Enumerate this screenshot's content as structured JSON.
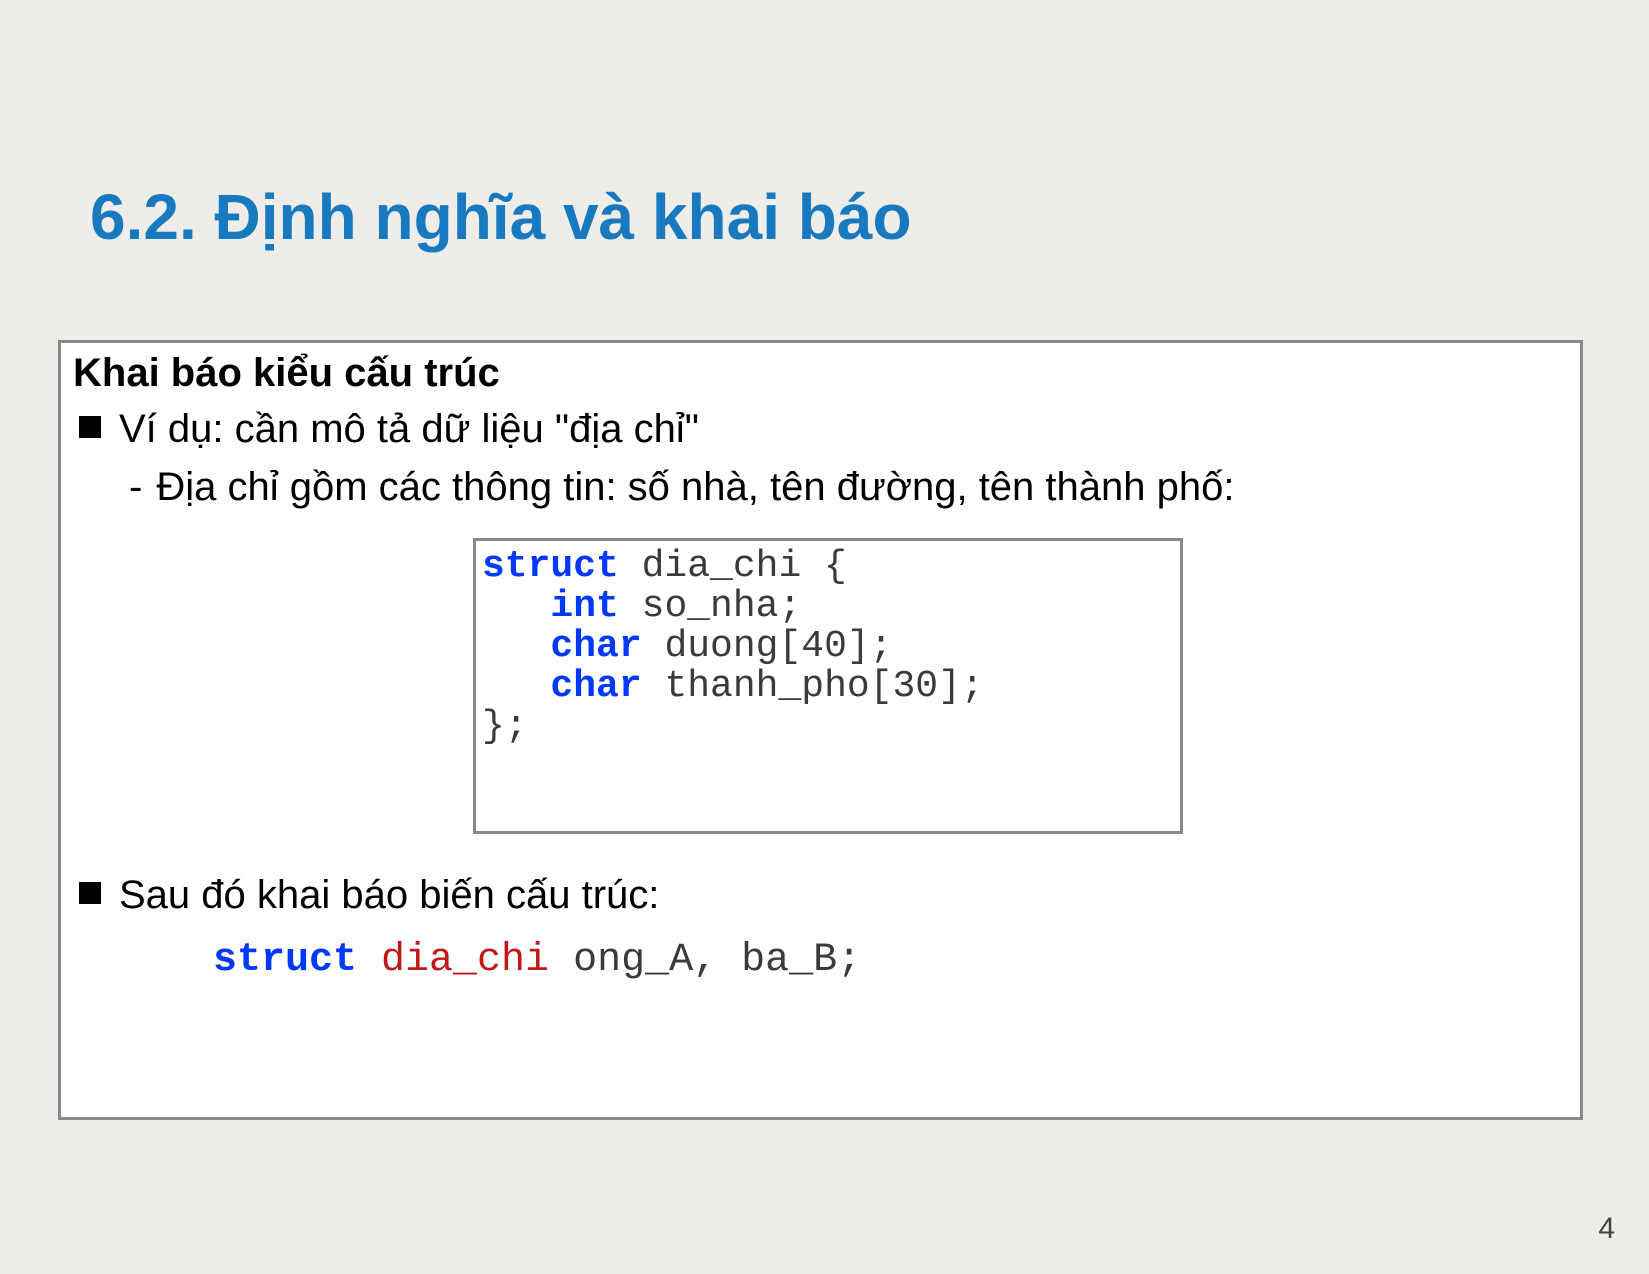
{
  "title": "6.2. Định nghĩa và khai báo",
  "section_header": "Khai báo kiểu cấu trúc",
  "bullet1": "Ví dụ: cần mô tả dữ liệu \"địa chỉ\"",
  "bullet2": "Địa chỉ gồm các thông tin: số nhà, tên đường, tên thành phố:",
  "code": {
    "kw_struct": "struct",
    "t1": " dia_chi {",
    "indent": "   ",
    "kw_int": "int",
    "t2": " so_nha;",
    "kw_char1": "char",
    "t3": " duong[40];",
    "kw_char2": "char",
    "t4": " thanh_pho[30];",
    "t5": "};"
  },
  "bullet3": "Sau đó khai báo biến cấu trúc:",
  "decl": {
    "kw": "struct",
    "type": " dia_chi",
    "rest": " ong_A, ba_B;"
  },
  "page_number": "4"
}
